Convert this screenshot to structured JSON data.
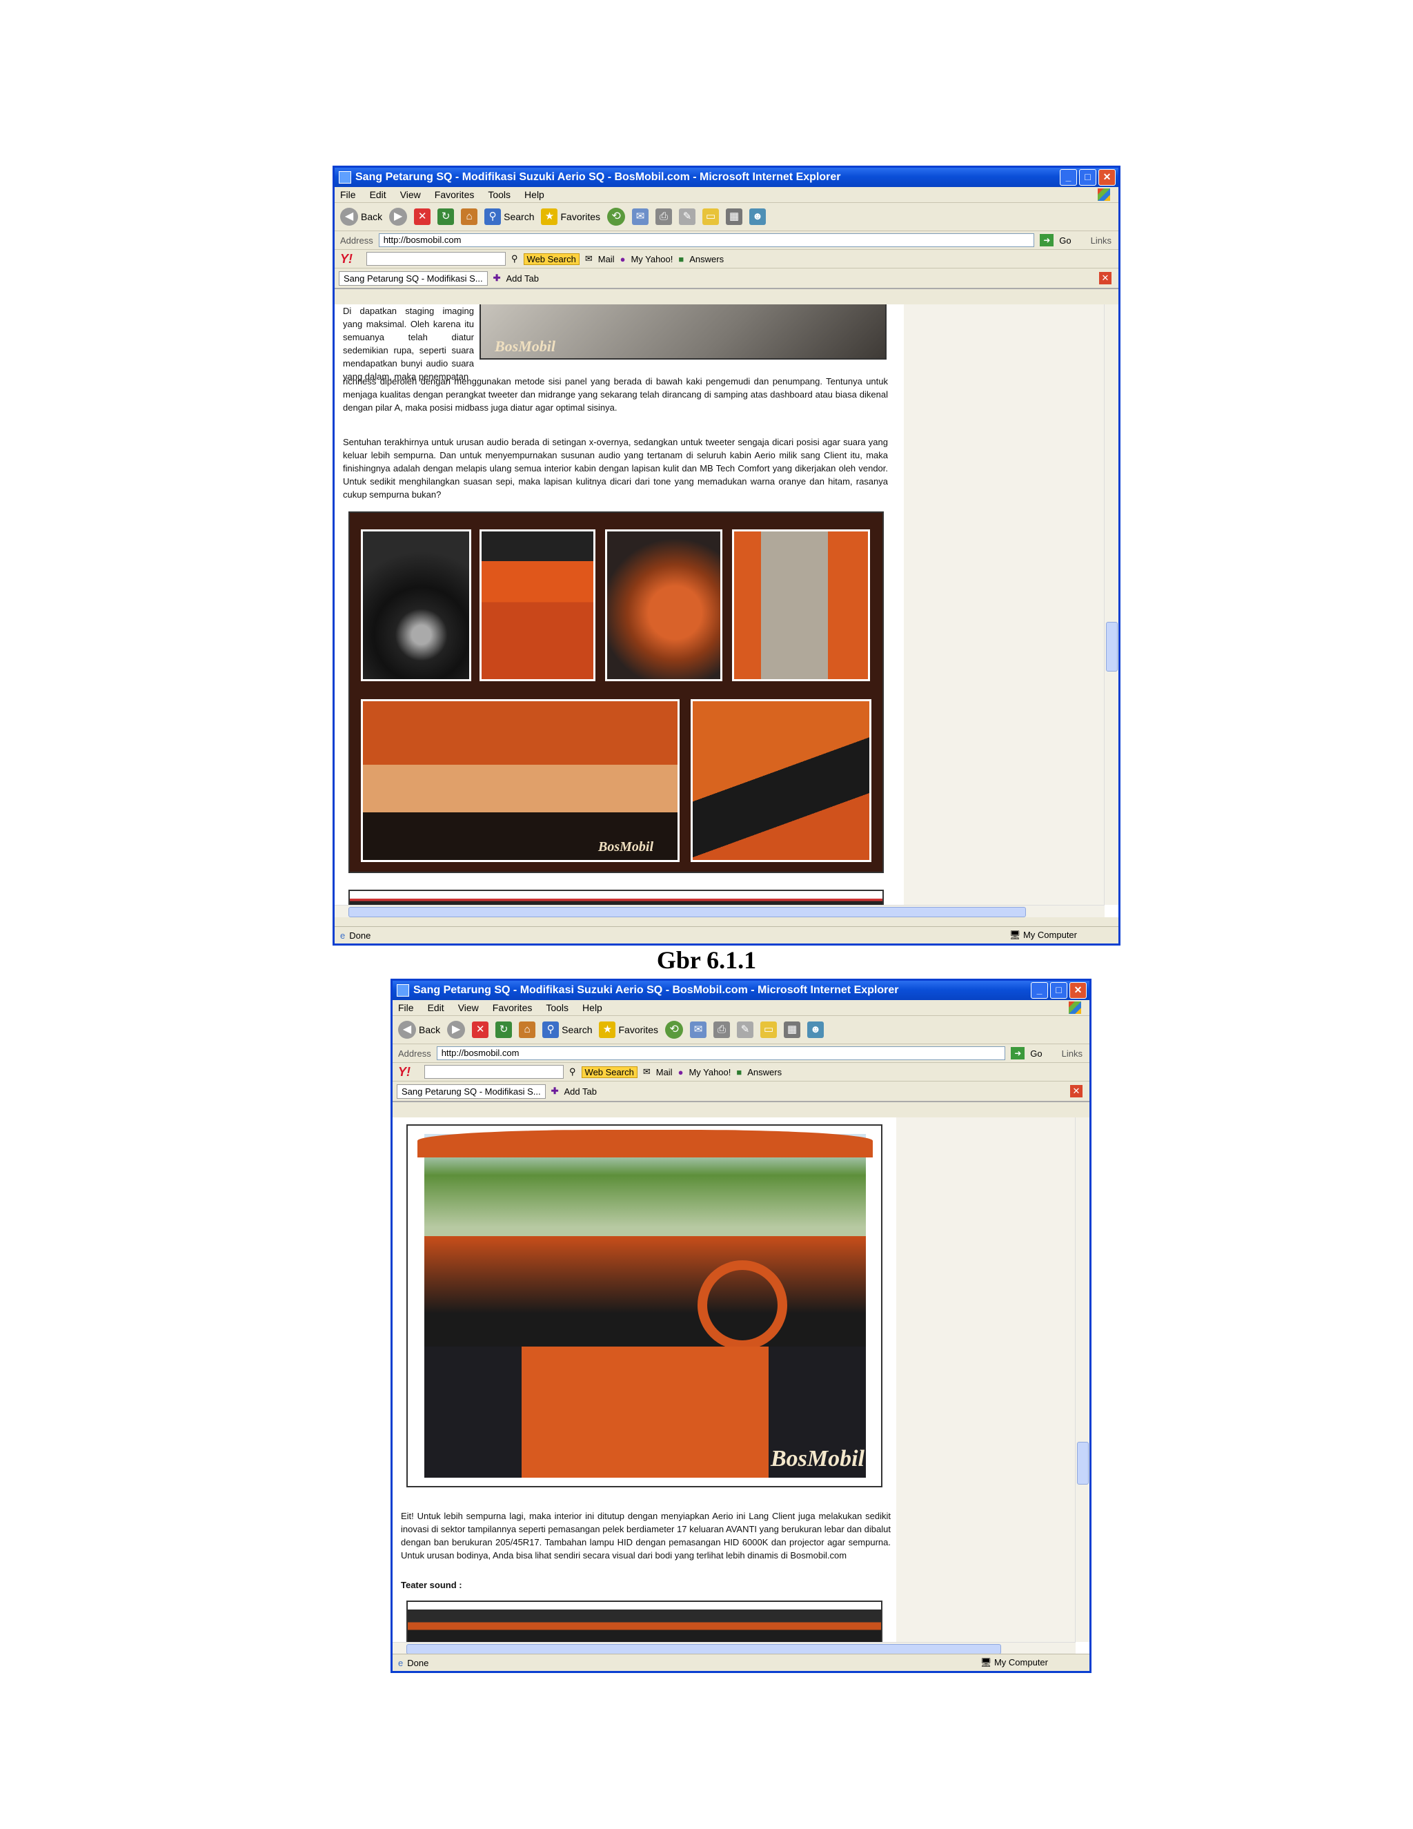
{
  "browser": {
    "title": "Sang Petarung SQ - Modifikasi Suzuki Aerio SQ - BosMobil.com - Microsoft Internet Explorer",
    "menu": [
      "File",
      "Edit",
      "View",
      "Favorites",
      "Tools",
      "Help"
    ],
    "toolbar": {
      "back": "Back",
      "search": "Search",
      "favorites": "Favorites"
    },
    "address_label": "Address",
    "address_value": "http://bosmobil.com",
    "go_label": "Go",
    "links_label": "Links",
    "yahoo": {
      "web_search": "Web Search",
      "mail": "Mail",
      "my_yahoo": "My Yahoo!",
      "answers": "Answers"
    },
    "tab_label": "Sang Petarung SQ - Modifikasi S...",
    "add_tab": "Add Tab",
    "status_left": "Done",
    "status_right": "My Computer"
  },
  "screenshot1": {
    "wrap_text": "Di dapatkan staging imaging yang maksimal. Oleh karena itu semuanya telah diatur sedemikian rupa, seperti suara mendapatkan bunyi audio suara yang dalam, maka penempatan",
    "para1": "richness diperoleh dengan menggunakan metode sisi panel yang berada di bawah kaki pengemudi dan penumpang. Tentunya untuk menjaga kualitas dengan perangkat tweeter dan midrange yang sekarang telah dirancang di samping atas dashboard atau biasa dikenal dengan pilar A, maka posisi midbass juga diatur agar optimal sisinya.",
    "para2": "Sentuhan terakhirnya untuk urusan audio berada di setingan x-overnya, sedangkan untuk tweeter sengaja dicari posisi agar suara yang keluar lebih sempurna. Dan untuk menyempurnakan susunan audio yang tertanam di seluruh kabin Aerio milik sang Client itu, maka finishingnya adalah dengan melapis ulang semua interior kabin dengan lapisan kulit dan MB Tech Comfort yang dikerjakan oleh vendor. Untuk sedikit menghilangkan suasan sepi, maka lapisan kulitnya dicari dari tone yang memadukan warna oranye dan hitam, rasanya cukup sempurna bukan?",
    "watermark": "BosMobil"
  },
  "caption": "Gbr 6.1.1",
  "screenshot2": {
    "para1": "Eit! Untuk lebih sempurna lagi, maka interior ini ditutup dengan menyiapkan Aerio ini Lang Client juga melakukan sedikit inovasi di sektor tampilannya seperti pemasangan pelek berdiameter 17 keluaran AVANTI yang berukuran lebar dan dibalut dengan ban berukuran 205/45R17. Tambahan lampu HID dengan pemasangan HID 6000K dan projector agar sempurna. Untuk urusan bodinya, Anda bisa lihat sendiri secara visual dari bodi yang terlihat lebih dinamis di Bosmobil.com",
    "heading": "Teater sound :",
    "watermark": "BosMobil"
  }
}
